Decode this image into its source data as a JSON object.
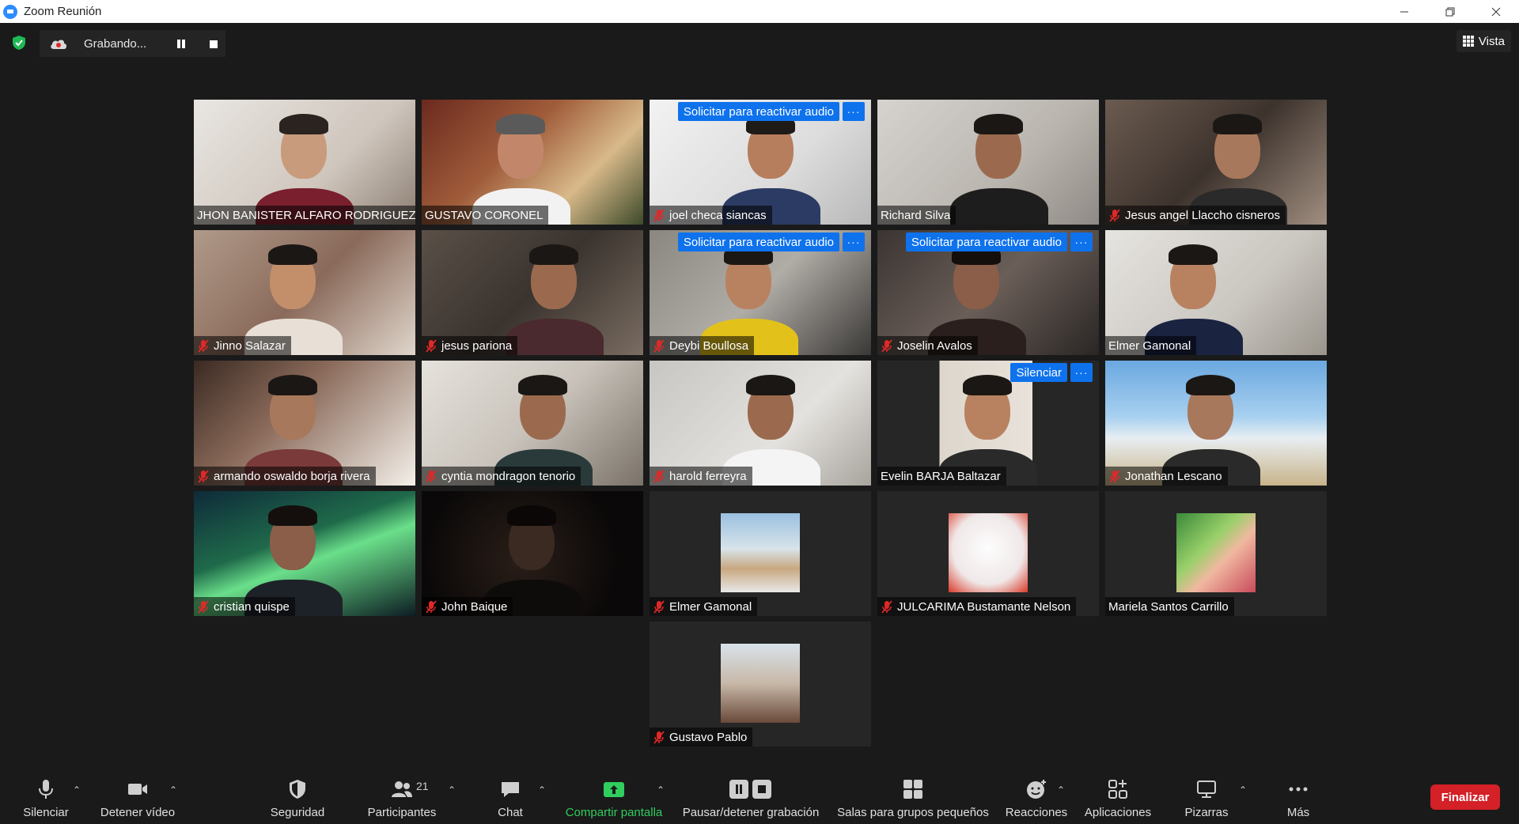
{
  "window": {
    "title": "Zoom Reunión"
  },
  "recording": {
    "status": "Grabando..."
  },
  "view": {
    "label": "Vista"
  },
  "tiles": [
    {
      "name": "JHON BANISTER ALFARO RODRIGUEZ",
      "muted": false
    },
    {
      "name": "GUSTAVO CORONEL",
      "muted": false
    },
    {
      "name": "joel checa siancas",
      "muted": true,
      "request": "Solicitar para reactivar audio"
    },
    {
      "name": "Richard Silva",
      "muted": false,
      "speaking": true
    },
    {
      "name": "Jesus angel Llaccho cisneros",
      "muted": true
    },
    {
      "name": "Jinno Salazar",
      "muted": true
    },
    {
      "name": "jesus pariona",
      "muted": true
    },
    {
      "name": "Deybi Boullosa",
      "muted": true,
      "request": "Solicitar para reactivar audio"
    },
    {
      "name": "Joselin Avalos",
      "muted": true,
      "request": "Solicitar para reactivar audio"
    },
    {
      "name": "Elmer Gamonal",
      "muted": false
    },
    {
      "name": "armando oswaldo borja rivera",
      "muted": true
    },
    {
      "name": "cyntia mondragon tenorio",
      "muted": true
    },
    {
      "name": "harold ferreyra",
      "muted": true
    },
    {
      "name": "Evelin BARJA  Baltazar",
      "muted": false,
      "request": "Silenciar"
    },
    {
      "name": "Jonathan Lescano",
      "muted": true
    },
    {
      "name": "cristian quispe",
      "muted": true
    },
    {
      "name": "John Baique",
      "muted": true
    },
    {
      "name": "Elmer Gamonal",
      "muted": true
    },
    {
      "name": "JULCARIMA Bustamante Nelson",
      "muted": true
    },
    {
      "name": "Mariela Santos Carrillo",
      "muted": false
    },
    {
      "name": "Gustavo Pablo",
      "muted": true
    }
  ],
  "toolbar": {
    "mute": "Silenciar",
    "video": "Detener vídeo",
    "security": "Seguridad",
    "participants": "Participantes",
    "participants_count": "21",
    "chat": "Chat",
    "share": "Compartir pantalla",
    "record": "Pausar/detener grabación",
    "breakout": "Salas para grupos pequeños",
    "reactions": "Reacciones",
    "apps": "Aplicaciones",
    "whiteboards": "Pizarras",
    "more": "Más",
    "end": "Finalizar"
  },
  "colors": {
    "accent": "#0e72ed",
    "share_green": "#2fce5e",
    "end_red": "#d42027",
    "speaking_outline": "#d8e85a"
  }
}
